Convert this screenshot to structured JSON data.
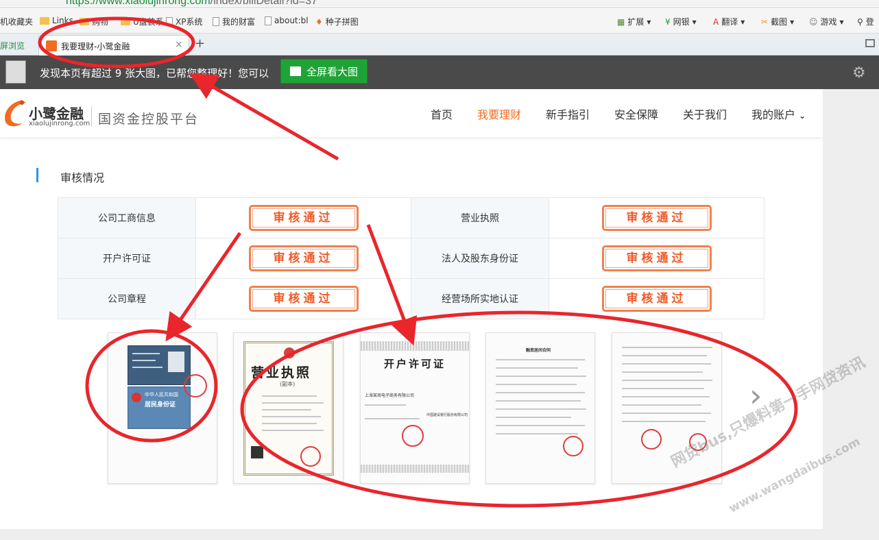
{
  "browser": {
    "url_scheme": "https://www.",
    "url_domain": "xiaolujinrong.com",
    "url_path": "/index/billDetail?id=37",
    "bookmarks": [
      "机收藏夹",
      "Links",
      "购物",
      "U盘装系",
      "XP系统",
      "我的财富",
      "about:bl",
      "种子拼图"
    ],
    "toolbar_right": [
      "扩展",
      "网银",
      "翻译",
      "截图",
      "游戏",
      "登"
    ],
    "left_clip": "屏浏览",
    "tab_title": "我要理财-小鹭金融",
    "new_tab": "+",
    "close_tab": "×"
  },
  "adbar": {
    "text": "发现本页有超过 9 张大图，已帮您整理好！您可以",
    "button": "全屏看大图"
  },
  "site": {
    "logo_name": "小鹭金融",
    "logo_url": "xiaolujinrong.com",
    "slogan": "国资金控股平台",
    "nav": [
      "首页",
      "我要理财",
      "新手指引",
      "安全保障",
      "关于我们",
      "我的账户"
    ],
    "nav_active_color": "#f26b21"
  },
  "section": {
    "title": "审核情况",
    "accent_color": "#2196f3"
  },
  "audit": {
    "stamp_text": "审核通过",
    "stamp_color": "#f05a28",
    "rows": [
      {
        "left": "公司工商信息",
        "right": "营业执照"
      },
      {
        "left": "开户许可证",
        "right": "法人及股东身份证"
      },
      {
        "left": "公司章程",
        "right": "经营场所实地认证"
      }
    ]
  },
  "thumbnails": {
    "license_title": "营业执照",
    "license_sub": "(副本)",
    "account_title": "开户许可证",
    "contract_title": "融资居间合同",
    "id_title": "中华人民共和国",
    "id_sub": "居民身份证",
    "account_company": "上海某商电子商务有限公司",
    "account_bank": "中国建设银行股份有限公司"
  },
  "annotation_color": "#e8262c",
  "watermark": {
    "line1": "网贷bus,只爆料第一手网贷资讯",
    "line2": "www.wangdaibus.com"
  }
}
